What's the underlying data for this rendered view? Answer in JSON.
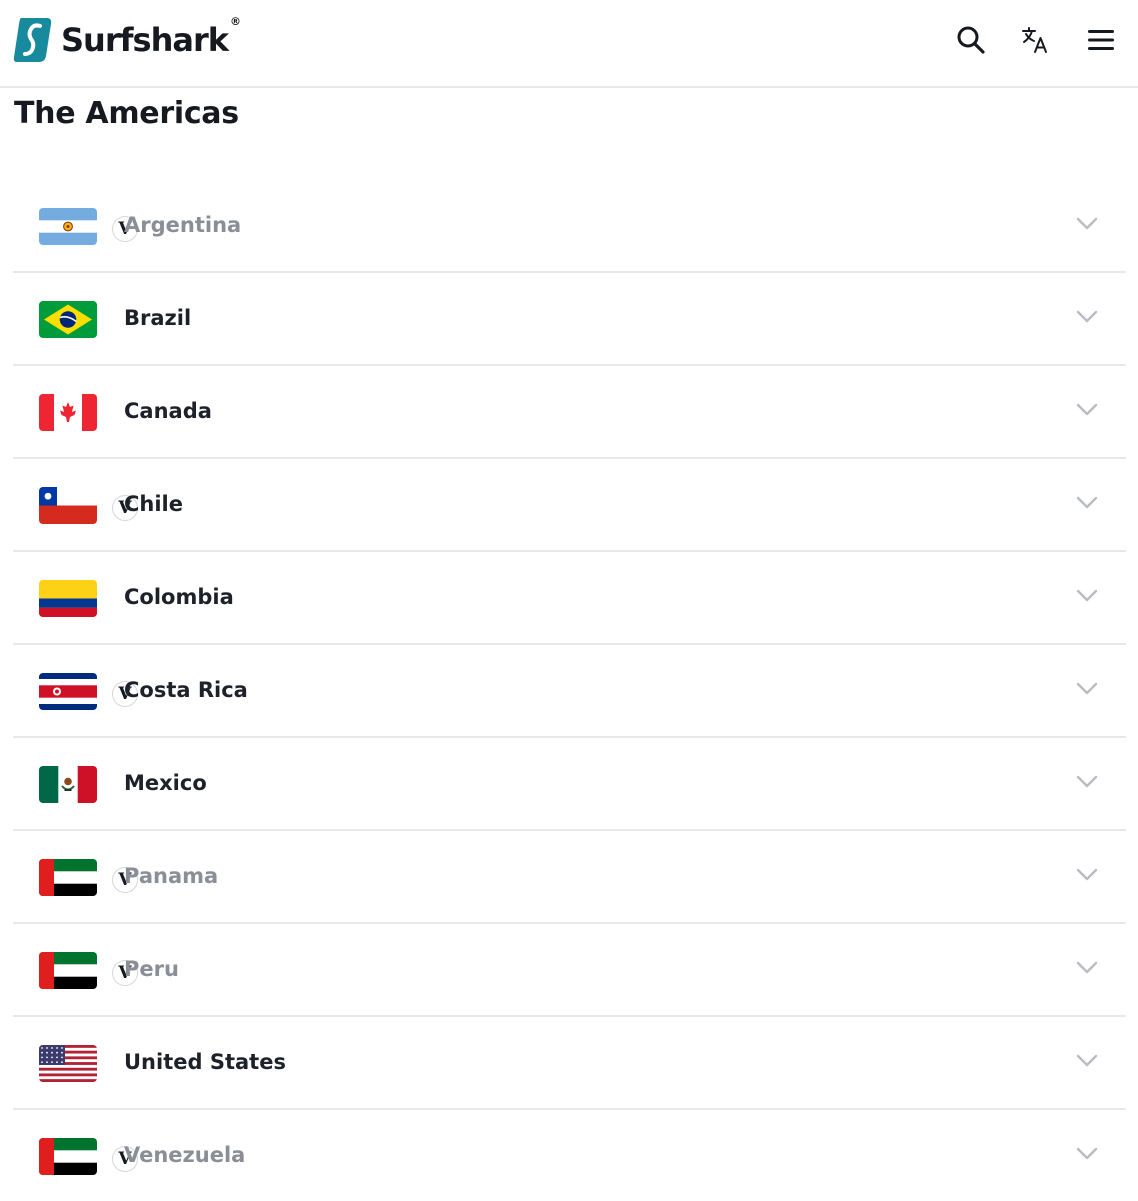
{
  "brand": {
    "name": "Surfshark",
    "reg": "®",
    "color": "#178a9e"
  },
  "header": {
    "icons": [
      "search-icon",
      "translate-icon",
      "menu-icon"
    ]
  },
  "page": {
    "title": "The Americas"
  },
  "badge_label": "V",
  "countries": [
    {
      "name": "Argentina",
      "flag": "argentina",
      "badge": true,
      "muted": true
    },
    {
      "name": "Brazil",
      "flag": "brazil",
      "badge": false,
      "muted": false
    },
    {
      "name": "Canada",
      "flag": "canada",
      "badge": false,
      "muted": false
    },
    {
      "name": "Chile",
      "flag": "chile",
      "badge": true,
      "muted": false
    },
    {
      "name": "Colombia",
      "flag": "colombia",
      "badge": false,
      "muted": false
    },
    {
      "name": "Costa Rica",
      "flag": "costa-rica",
      "badge": true,
      "muted": false
    },
    {
      "name": "Mexico",
      "flag": "mexico",
      "badge": false,
      "muted": false
    },
    {
      "name": "Panama",
      "flag": "uae",
      "badge": true,
      "muted": true
    },
    {
      "name": "Peru",
      "flag": "uae",
      "badge": true,
      "muted": true
    },
    {
      "name": "United States",
      "flag": "usa",
      "badge": false,
      "muted": false
    },
    {
      "name": "Venezuela",
      "flag": "uae",
      "badge": true,
      "muted": true
    }
  ],
  "colors": {
    "text": "#1d2129",
    "muted_text": "#8a8e96",
    "divider": "#e8e8ea",
    "chevron": "#b9bcc2"
  }
}
